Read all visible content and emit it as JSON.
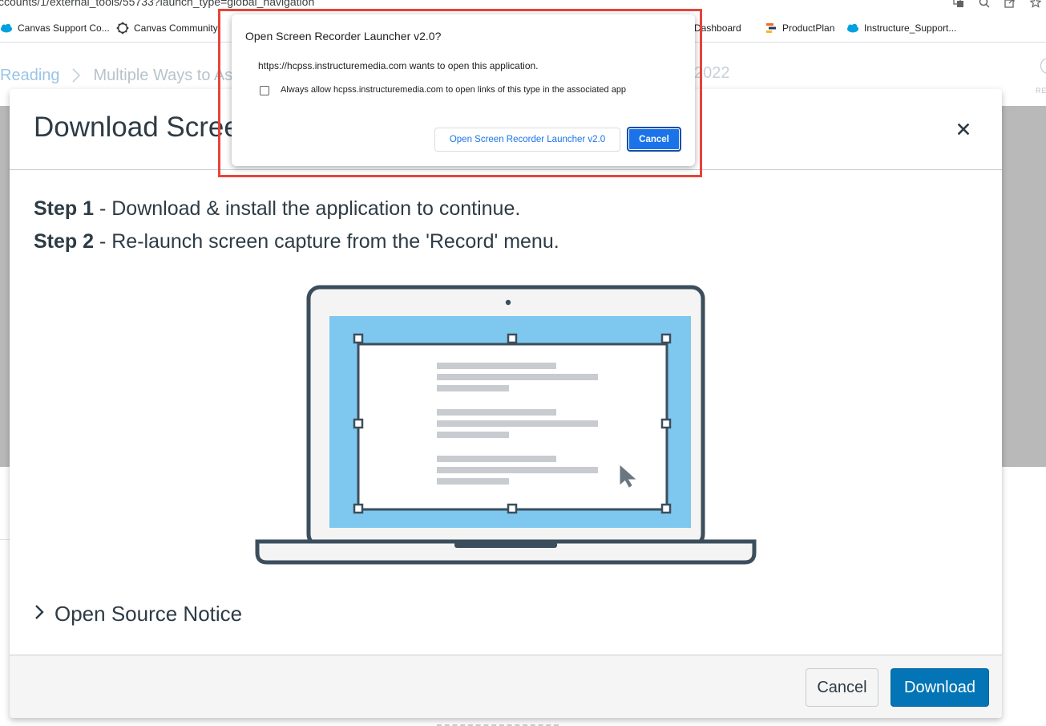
{
  "browser": {
    "url": "ccounts/1/external_tools/55733?launch_type=global_navigation",
    "icons": [
      "translate-icon",
      "zoom-icon",
      "share-icon",
      "star-icon"
    ],
    "bookmarks": [
      {
        "label": "Canvas Support Co...",
        "icon": "salesforce-cloud-icon"
      },
      {
        "label": "Canvas Community",
        "icon": "community-icon"
      },
      {
        "label": "Dashboard",
        "icon": "cloud-icon"
      },
      {
        "label": "ProductPlan",
        "icon": "productplan-icon"
      },
      {
        "label": "Instructure_Support...",
        "icon": "salesforce-cloud-icon"
      }
    ]
  },
  "page": {
    "breadcrumb": {
      "item1": "Reading",
      "item2": "Multiple Ways to Ass",
      "year": "2022"
    },
    "right_label": "RE"
  },
  "modal": {
    "title": "Download Scree",
    "close_label": "×",
    "step1": {
      "bold": "Step 1",
      "text": " - Download & install the application to continue."
    },
    "step2": {
      "bold": "Step 2",
      "text": " - Re-launch screen capture from the 'Record' menu."
    },
    "illustration_icon": "laptop-screen-capture-illustration",
    "open_source_notice": "Open Source Notice",
    "buttons": {
      "cancel": "Cancel",
      "download": "Download"
    },
    "colors": {
      "primary": "#0374b5",
      "screen": "#7ec8ef",
      "outline": "#3c4e5c"
    }
  },
  "protocol_dialog": {
    "title": "Open Screen Recorder Launcher v2.0?",
    "message": "https://hcpss.instructuremedia.com wants to open this application.",
    "checkbox_label": "Always allow hcpss.instructuremedia.com to open links of this type in the associated app",
    "checkbox_checked": false,
    "open_button": "Open Screen Recorder Launcher v2.0",
    "cancel_button": "Cancel",
    "highlight_color": "#e8443a"
  }
}
